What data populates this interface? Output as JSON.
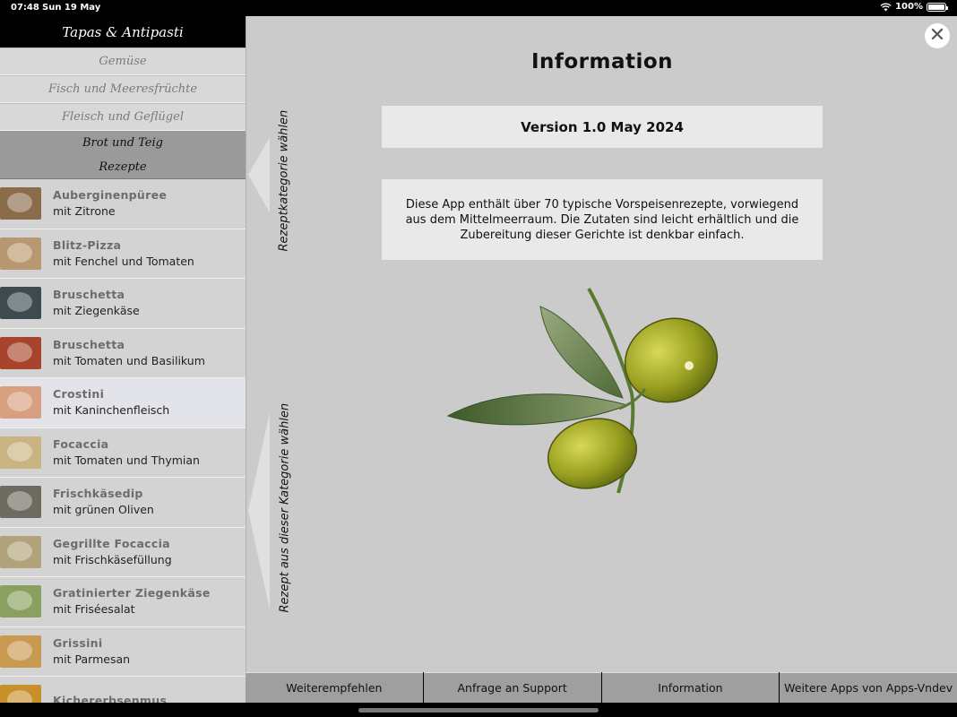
{
  "status": {
    "time": "07:48",
    "date": "Sun 19 May",
    "battery": "100%",
    "battery_level": 1.0
  },
  "sidebar": {
    "title": "Tapas & Antipasti",
    "categories": [
      "Gemüse",
      "Fisch und Meeresfrüchte",
      "Fleisch und Geflügel",
      "Brot und Teig"
    ],
    "section_header": "Rezepte",
    "recipes": [
      {
        "title": "Auberginenpüree",
        "subtitle": "mit Zitrone",
        "color": "#8a6b4a"
      },
      {
        "title": "Blitz-Pizza",
        "subtitle": "mit Fenchel und Tomaten",
        "color": "#b89870"
      },
      {
        "title": "Bruschetta",
        "subtitle": "mit Ziegenkäse",
        "color": "#3d4a4e"
      },
      {
        "title": "Bruschetta",
        "subtitle": "mit Tomaten und Basilikum",
        "color": "#a8442c"
      },
      {
        "title": "Crostini",
        "subtitle": "mit Kaninchenfleisch",
        "color": "#d8a080"
      },
      {
        "title": "Focaccia",
        "subtitle": "mit Tomaten und Thymian",
        "color": "#c9b380"
      },
      {
        "title": "Frischkäsedip",
        "subtitle": "mit grünen Oliven",
        "color": "#6e6a60"
      },
      {
        "title": "Gegrillte Focaccia",
        "subtitle": "mit Frischkäsefüllung",
        "color": "#b0a27a"
      },
      {
        "title": "Gratinierter Ziegenkäse",
        "subtitle": "mit Friséesalat",
        "color": "#8aa060"
      },
      {
        "title": "Grissini",
        "subtitle": "mit Parmesan",
        "color": "#c89a50"
      },
      {
        "title": "Kichererbsenmus",
        "subtitle": "",
        "color": "#c8902a"
      }
    ]
  },
  "main": {
    "vertical_label_top": "Rezeptkategorie wählen",
    "vertical_label_bottom": "Rezept aus dieser Kategorie wählen",
    "close_symbol": "✕",
    "title": "Information",
    "version": "Version 1.0 May 2024",
    "description": "Diese App enthält über 70 typische Vorspeisenrezepte, vorwiegend aus dem Mittelmeerraum. Die Zutaten sind leicht erhältlich und die Zubereitung dieser Gerichte ist denkbar einfach."
  },
  "toolbar": {
    "buttons": [
      "Weiterempfehlen",
      "Anfrage an Support",
      "Information",
      "Weitere Apps von Apps-Vndev"
    ]
  },
  "colors": {
    "olive_light": "#c2c238",
    "olive_dark": "#5e6a10",
    "leaf": "#5c7a3a"
  }
}
